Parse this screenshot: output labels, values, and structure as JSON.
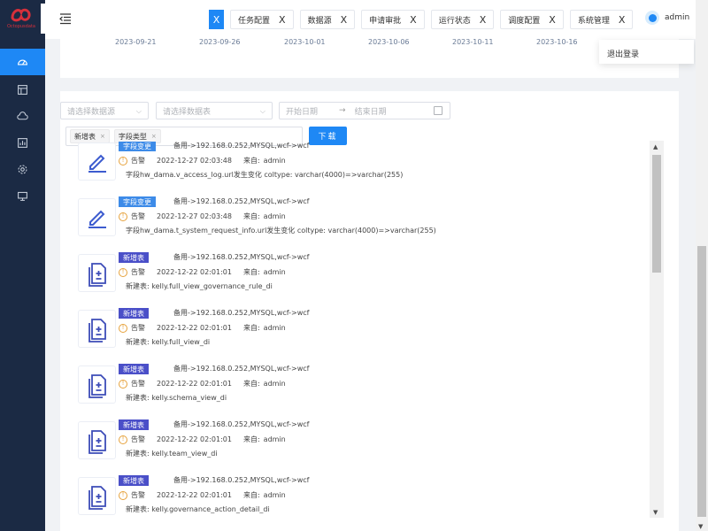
{
  "brand": {
    "sub": "Octopusdata",
    "accent": "#d6303b",
    "sidebar_bg": "#1b2a44",
    "primary": "#1e88f5"
  },
  "sidebar": {
    "items": [
      {
        "icon": "dashboard-icon",
        "active": true
      },
      {
        "icon": "layout-icon",
        "active": false
      },
      {
        "icon": "cloud-icon",
        "active": false
      },
      {
        "icon": "chart-icon",
        "active": false
      },
      {
        "icon": "gear-icon",
        "active": false
      },
      {
        "icon": "monitor-icon",
        "active": false
      }
    ]
  },
  "header": {
    "first_tab_close": "X",
    "tabs": [
      {
        "label": "任务配置",
        "close": "X"
      },
      {
        "label": "数据源",
        "close": "X"
      },
      {
        "label": "申请审批",
        "close": "X"
      },
      {
        "label": "运行状态",
        "close": "X"
      },
      {
        "label": "调度配置",
        "close": "X"
      },
      {
        "label": "系统管理",
        "close": "X"
      }
    ],
    "user": "admin"
  },
  "dates": [
    "2023-09-21",
    "2023-09-26",
    "2023-10-01",
    "2023-10-06",
    "2023-10-11",
    "2023-10-16"
  ],
  "user_menu": {
    "logout": "退出登录"
  },
  "filters": {
    "datasource_placeholder": "请选择数据源",
    "table_placeholder": "请选择数据表",
    "start_placeholder": "开始日期",
    "range_sep": "→",
    "end_placeholder": "结束日期",
    "tags": [
      {
        "label": "新增表",
        "close": "×"
      },
      {
        "label": "字段类型",
        "close": "×"
      }
    ],
    "download_label": "下载"
  },
  "events": [
    {
      "type": "字段变更",
      "icon": "edit-icon",
      "color": "blue",
      "path": "备用->192.168.0.252,MYSQL,wcf->wcf",
      "level": "告警",
      "time": "2022-12-27 02:03:48",
      "source_label": "来自:",
      "user": "admin",
      "detail": "字段hw_dama.v_access_log.url发生变化 coltype: varchar(4000)=>varchar(255)"
    },
    {
      "type": "字段变更",
      "icon": "edit-icon",
      "color": "blue",
      "path": "备用->192.168.0.252,MYSQL,wcf->wcf",
      "level": "告警",
      "time": "2022-12-27 02:03:48",
      "source_label": "来自:",
      "user": "admin",
      "detail": "字段hw_dama.t_system_request_info.url发生变化 coltype: varchar(4000)=>varchar(255)"
    },
    {
      "type": "新增表",
      "icon": "add-file-icon",
      "color": "indigo",
      "path": "备用->192.168.0.252,MYSQL,wcf->wcf",
      "level": "告警",
      "time": "2022-12-22 02:01:01",
      "source_label": "来自:",
      "user": "admin",
      "detail": "新建表: kelly.full_view_governance_rule_di"
    },
    {
      "type": "新增表",
      "icon": "add-file-icon",
      "color": "indigo",
      "path": "备用->192.168.0.252,MYSQL,wcf->wcf",
      "level": "告警",
      "time": "2022-12-22 02:01:01",
      "source_label": "来自:",
      "user": "admin",
      "detail": "新建表: kelly.full_view_di"
    },
    {
      "type": "新增表",
      "icon": "add-file-icon",
      "color": "indigo",
      "path": "备用->192.168.0.252,MYSQL,wcf->wcf",
      "level": "告警",
      "time": "2022-12-22 02:01:01",
      "source_label": "来自:",
      "user": "admin",
      "detail": "新建表: kelly.schema_view_di"
    },
    {
      "type": "新增表",
      "icon": "add-file-icon",
      "color": "indigo",
      "path": "备用->192.168.0.252,MYSQL,wcf->wcf",
      "level": "告警",
      "time": "2022-12-22 02:01:01",
      "source_label": "来自:",
      "user": "admin",
      "detail": "新建表: kelly.team_view_di"
    },
    {
      "type": "新增表",
      "icon": "add-file-icon",
      "color": "indigo",
      "path": "备用->192.168.0.252,MYSQL,wcf->wcf",
      "level": "告警",
      "time": "2022-12-22 02:01:01",
      "source_label": "来自:",
      "user": "admin",
      "detail": "新建表: kelly.governance_action_detail_di"
    }
  ]
}
